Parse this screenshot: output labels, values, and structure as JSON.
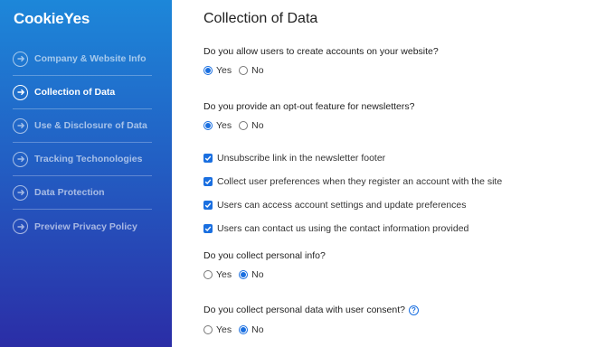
{
  "brand": {
    "logo_text": "CookieYes"
  },
  "sidebar": {
    "items": [
      {
        "label": "Company & Website Info",
        "active": false
      },
      {
        "label": "Collection of Data",
        "active": true
      },
      {
        "label": "Use & Disclosure of Data",
        "active": false
      },
      {
        "label": "Tracking Techonologies",
        "active": false
      },
      {
        "label": "Data Protection",
        "active": false
      },
      {
        "label": "Preview Privacy Policy",
        "active": false
      }
    ]
  },
  "main": {
    "title": "Collection of Data",
    "questions": [
      {
        "text": "Do you allow users to create accounts on your website?",
        "options": [
          "Yes",
          "No"
        ],
        "selected": "Yes"
      },
      {
        "text": "Do you provide an opt-out feature for newsletters?",
        "options": [
          "Yes",
          "No"
        ],
        "selected": "Yes"
      },
      {
        "text": "Do you collect personal info?",
        "options": [
          "Yes",
          "No"
        ],
        "selected": "No"
      },
      {
        "text": "Do you collect personal data with user consent?",
        "options": [
          "Yes",
          "No"
        ],
        "selected": "No"
      }
    ],
    "checkboxes": [
      {
        "label": "Unsubscribe link in the newsletter footer",
        "checked": true
      },
      {
        "label": "Collect user preferences when they register an account with the site",
        "checked": true
      },
      {
        "label": "Users can access account settings and update preferences",
        "checked": true
      },
      {
        "label": "Users can contact us using the contact information provided",
        "checked": true
      }
    ],
    "help_icon": "?"
  },
  "colors": {
    "accent": "#1a6fe0",
    "sidebar_top": "#1d87d9",
    "sidebar_bottom": "#2b2da6"
  },
  "icons": {
    "nav": "arrow-right-circle-icon",
    "check": "check-icon",
    "help": "question-circle-icon"
  }
}
